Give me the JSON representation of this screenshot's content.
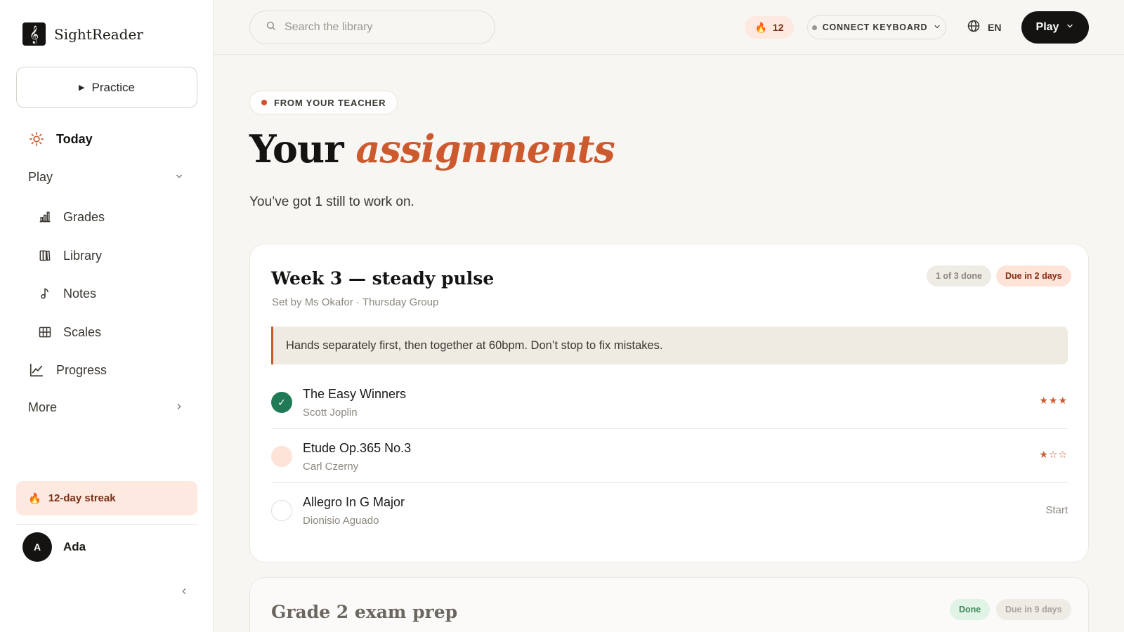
{
  "app": {
    "name": "SightReader",
    "logo_glyph": "𝄞"
  },
  "sidebar": {
    "practice_label": "Practice",
    "today_label": "Today",
    "play_group": {
      "label": "Play"
    },
    "items": [
      {
        "label": "Grades",
        "icon": "bar-chart-icon"
      },
      {
        "label": "Library",
        "icon": "library-icon"
      },
      {
        "label": "Notes",
        "icon": "music-note-icon"
      },
      {
        "label": "Scales",
        "icon": "piano-keys-icon"
      }
    ],
    "progress_label": "Progress",
    "more_label": "More",
    "streak_label": "12-day streak",
    "user": {
      "initial": "A",
      "name": "Ada"
    }
  },
  "topbar": {
    "search_placeholder": "Search the library",
    "streak_count": "12",
    "connect_label": "CONNECT KEYBOARD",
    "language": "EN",
    "play_label": "Play"
  },
  "main": {
    "badge": "FROM YOUR TEACHER",
    "title_plain": "Your ",
    "title_accent": "assignments",
    "subtitle": "You’ve got 1 still to work on.",
    "assignments": [
      {
        "title": "Week 3 — steady pulse",
        "meta": "Set by Ms Okafor · Thursday Group",
        "progress": "1 of 3 done",
        "due": "Due in 2 days",
        "note": "Hands separately first, then together at 60bpm. Don’t stop to fix mistakes.",
        "pieces": [
          {
            "title": "The Easy Winners",
            "composer": "Scott Joplin",
            "status": "done",
            "stars": 3,
            "stars_text": "★★★"
          },
          {
            "title": "Etude Op.365 No.3",
            "composer": "Carl Czerny",
            "status": "in-progress",
            "stars": 1,
            "stars_text": "★☆☆"
          },
          {
            "title": "Allegro In G Major",
            "composer": "Dionisio Aguado",
            "status": "not-started",
            "action": "Start"
          }
        ]
      },
      {
        "title": "Grade 2 exam prep",
        "status": "Done",
        "due": "Due in 9 days"
      }
    ]
  },
  "colors": {
    "accent": "#cc5a2e",
    "ink": "#141311",
    "success": "#1f7a55",
    "streak_bg": "#fde9df",
    "background": "#f8f6f2"
  }
}
